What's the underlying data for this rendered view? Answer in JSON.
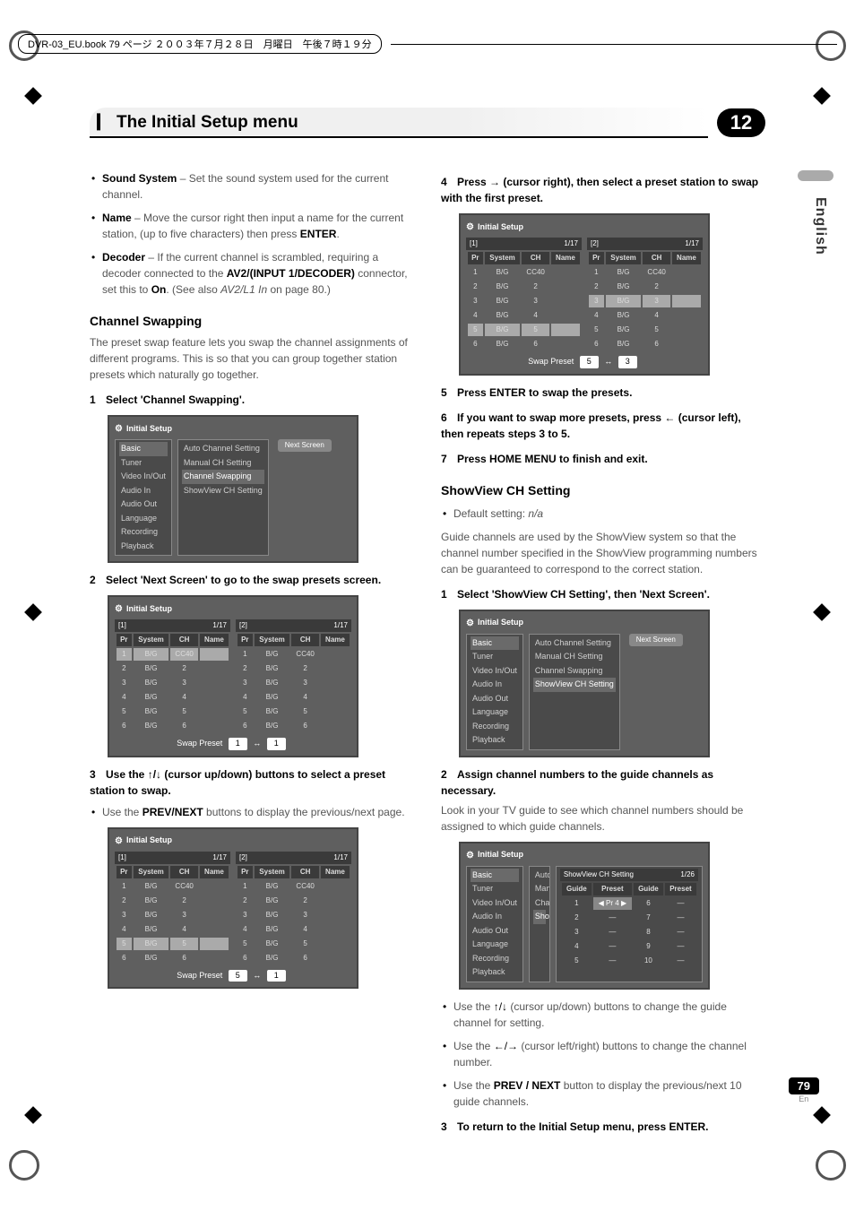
{
  "print_header": "DVR-03_EU.book 79 ページ ２００３年７月２８日　月曜日　午後７時１９分",
  "chapter_num": "12",
  "header_title": "The Initial Setup menu",
  "side_label": "English",
  "page_num": "79",
  "page_lang": "En",
  "left": {
    "bullet_sound_label": "Sound System",
    "bullet_sound_text": " – Set the sound system used for the current channel.",
    "bullet_name_label": "Name",
    "bullet_name_text": " – Move the cursor right then input a name for the current station, (up to five characters) then press ",
    "bullet_name_btn": "ENTER",
    "bullet_decoder_label": "Decoder",
    "bullet_decoder_text": " – If the current channel is scrambled, requiring a decoder connected to the ",
    "bullet_decoder_conn": "AV2/(INPUT 1/DECODER)",
    "bullet_decoder_text2": " connector, set this to ",
    "bullet_decoder_on": "On",
    "bullet_decoder_text3": ". (See also ",
    "bullet_decoder_ref": "AV2/L1 In",
    "bullet_decoder_text4": " on page 80.)",
    "ch_swap_head": "Channel Swapping",
    "ch_swap_intro": "The preset swap feature lets you swap the channel assignments of different programs. This is so that you can group together station presets which naturally go together.",
    "step1": "Select 'Channel Swapping'.",
    "step2": "Select 'Next Screen' to go to the swap presets screen.",
    "step3a": "Use the ",
    "step3b": " (cursor up/down) buttons to select a preset station to swap.",
    "step3_note_a": "Use the ",
    "step3_note_b": "PREV/NEXT",
    "step3_note_c": " buttons to display the previous/next page.",
    "ui_title": "Initial Setup",
    "ui_menu_left": [
      "Basic",
      "Tuner",
      "Video In/Out",
      "Audio In",
      "Audio Out",
      "Language",
      "Recording",
      "Playback"
    ],
    "ui_menu_mid": [
      "Auto Channel Setting",
      "Manual CH Setting",
      "Channel Swapping",
      "ShowView CH Setting"
    ],
    "ui_btn_next": "Next Screen",
    "swap_label": "Swap Preset",
    "tbl_headers": [
      "Pr",
      "System",
      "CH",
      "Name"
    ],
    "tbl_page": "1/17",
    "tbl_rows": [
      [
        "1",
        "B/G",
        "CC40",
        ""
      ],
      [
        "2",
        "B/G",
        "2",
        ""
      ],
      [
        "3",
        "B/G",
        "3",
        ""
      ],
      [
        "4",
        "B/G",
        "4",
        ""
      ],
      [
        "5",
        "B/G",
        "5",
        ""
      ],
      [
        "6",
        "B/G",
        "6",
        ""
      ]
    ],
    "box_num1": "1",
    "box_num5": "5"
  },
  "right": {
    "step4a": "Press ",
    "step4b": " (cursor right), then select a preset station to swap with the first preset.",
    "step5": "Press ENTER to swap the presets.",
    "step6a": "If you want to swap more presets, press ",
    "step6b": " (cursor left), then repeats steps 3 to 5.",
    "step7": "Press HOME MENU to finish and exit.",
    "sv_head": "ShowView CH Setting",
    "sv_default_label": "Default setting: ",
    "sv_default_val": "n/a",
    "sv_intro": "Guide channels are used by the ShowView system so that the channel number specified in the ShowView programming numbers can be guaranteed to correspond to the correct station.",
    "sv_step1": "Select 'ShowView CH Setting', then 'Next Screen'.",
    "sv_step2": "Assign channel numbers to the guide channels as necessary.",
    "sv_step2_note": "Look in your TV guide to see which channel numbers should be assigned to which guide channels.",
    "sv_bullet1a": "Use the ",
    "sv_bullet1b": " (cursor up/down) buttons to change the guide channel for setting.",
    "sv_bullet2a": "Use the ",
    "sv_bullet2b": " (cursor left/right) buttons to change the channel number.",
    "sv_bullet3a": "Use the ",
    "sv_bullet3b": "PREV / NEXT",
    "sv_bullet3c": " button to display the previous/next 10 guide channels.",
    "sv_step3": "To return to the Initial Setup menu, press ENTER.",
    "sv_popup_title": "ShowView CH Setting",
    "sv_popup_page": "1/26",
    "sv_popup_cols": [
      "Guide",
      "Preset",
      "Guide",
      "Preset"
    ],
    "sv_popup_left_nums": [
      "1",
      "2",
      "3",
      "4",
      "5"
    ],
    "sv_popup_right_nums": [
      "6",
      "7",
      "8",
      "9",
      "10"
    ],
    "sv_popup_pr": "Pr 4",
    "ui_menu_mid_short": [
      "Auto",
      "Manu",
      "Chan",
      "Show"
    ]
  }
}
